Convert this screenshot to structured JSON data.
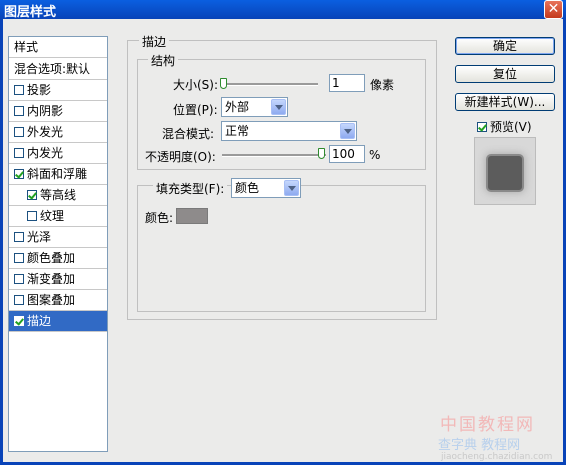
{
  "window": {
    "title": "图层样式"
  },
  "styles_list": {
    "header": "样式",
    "items": [
      {
        "label": "混合选项:默认",
        "has_checkbox": false,
        "checked": false,
        "indent": false,
        "selected": false
      },
      {
        "label": "投影",
        "has_checkbox": true,
        "checked": false,
        "indent": false,
        "selected": false
      },
      {
        "label": "内阴影",
        "has_checkbox": true,
        "checked": false,
        "indent": false,
        "selected": false
      },
      {
        "label": "外发光",
        "has_checkbox": true,
        "checked": false,
        "indent": false,
        "selected": false
      },
      {
        "label": "内发光",
        "has_checkbox": true,
        "checked": false,
        "indent": false,
        "selected": false
      },
      {
        "label": "斜面和浮雕",
        "has_checkbox": true,
        "checked": true,
        "indent": false,
        "selected": false
      },
      {
        "label": "等高线",
        "has_checkbox": true,
        "checked": true,
        "indent": true,
        "selected": false
      },
      {
        "label": "纹理",
        "has_checkbox": true,
        "checked": false,
        "indent": true,
        "selected": false
      },
      {
        "label": "光泽",
        "has_checkbox": true,
        "checked": false,
        "indent": false,
        "selected": false
      },
      {
        "label": "颜色叠加",
        "has_checkbox": true,
        "checked": false,
        "indent": false,
        "selected": false
      },
      {
        "label": "渐变叠加",
        "has_checkbox": true,
        "checked": false,
        "indent": false,
        "selected": false
      },
      {
        "label": "图案叠加",
        "has_checkbox": true,
        "checked": false,
        "indent": false,
        "selected": false
      },
      {
        "label": "描边",
        "has_checkbox": true,
        "checked": true,
        "indent": false,
        "selected": true
      }
    ]
  },
  "stroke": {
    "group_title": "描边",
    "structure_title": "结构",
    "size_label": "大小(S):",
    "size_value": "1",
    "size_unit": "像素",
    "position_label": "位置(P):",
    "position_value": "外部",
    "blend_label": "混合模式:",
    "blend_value": "正常",
    "opacity_label": "不透明度(O):",
    "opacity_value": "100",
    "opacity_unit": "%",
    "opacity_level": 1.0,
    "size_level": 0.0,
    "fill_type_label": "填充类型(F):",
    "fill_type_value": "颜色",
    "color_label": "颜色:",
    "color_hex": "#8e8b8b"
  },
  "buttons": {
    "ok": "确定",
    "reset": "复位",
    "new_style": "新建样式(W)..."
  },
  "preview": {
    "label": "预览(V)",
    "checked": true
  },
  "watermark": {
    "line1": "中国教程网",
    "line2": "查字典 教程网",
    "line3": "jiaocheng.chazidian.com"
  }
}
